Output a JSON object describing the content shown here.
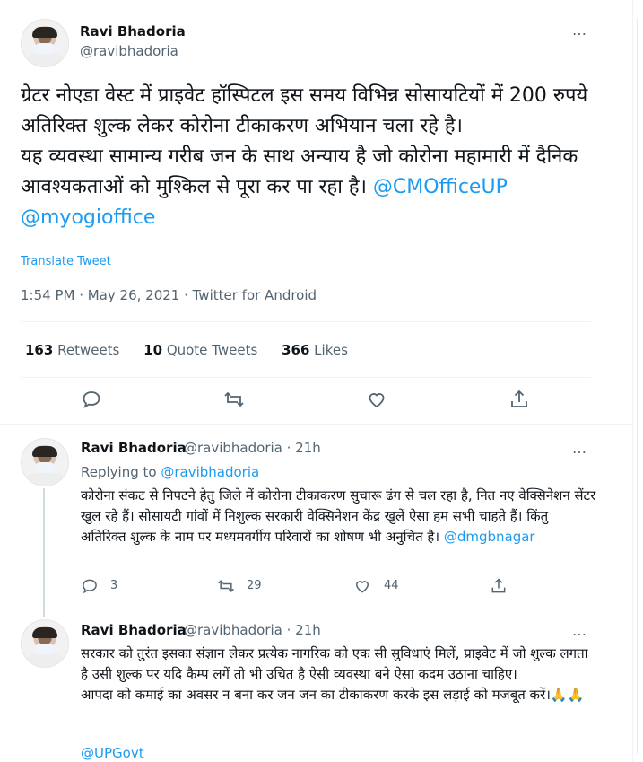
{
  "main_tweet": {
    "author_name": "Ravi Bhadoria",
    "author_handle": "@ravibhadoria",
    "more_icon": "…",
    "text": "ग्रेटर नोएडा वेस्ट में प्राइवेट हॉस्पिटल इस समय विभिन्न सोसायटियों में 200 रुपये अतिरिक्त शुल्क लेकर कोरोना टीकाकरण अभियान चला रहे है।\nयह व्यवस्था सामान्य गरीब जन के साथ अन्याय है जो कोरोना महामारी में दैनिक आवश्यकताओं को मुश्किल से पूरा कर पा रहा है। ",
    "mention_1": "@CMOfficeUP",
    "mention_2": "@myogioffice",
    "translate_label": "Translate Tweet",
    "meta": "1:54 PM · May 26, 2021 · Twitter for Android",
    "stats": {
      "retweets_count": "163",
      "retweets_label": "Retweets",
      "quote_count": "10",
      "quote_label": "Quote Tweets",
      "likes_count": "366",
      "likes_label": "Likes"
    }
  },
  "replies": [
    {
      "author_name": "Ravi Bhadoria",
      "author_handle": "@ravibhadoria · 21h",
      "more_icon": "…",
      "replying_label": "Replying to",
      "replying_handle": "@ravibhadoria",
      "text": "कोरोना संकट से निपटने हेतु जिले में कोरोना टीकाकरण सुचारू ढंग से चल रहा है, नित नए वेक्सिनेशन सेंटर खुल रहे हैं। सोसायटी गांवों में निशुल्क सरकारी वेक्सिनेशन केंद्र खुलें ऐसा हम सभी चाहते हैं। किंतु अतिरिक्त शुल्क के नाम पर मध्यमवर्गीय परिवारों का शोषण भी अनुचित है। ",
      "mention": "@dmgbnagar",
      "reply_count": "3",
      "retweet_count": "29",
      "like_count": "44"
    },
    {
      "author_name": "Ravi Bhadoria",
      "author_handle": "@ravibhadoria · 21h",
      "more_icon": "…",
      "text": "सरकार को तुरंत इसका संज्ञान लेकर प्रत्येक नागरिक को एक सी सुविधाएं मिलें, प्राइवेट में जो शुल्क लगता है उसी शुल्क पर यदि कैम्प लगें तो भी उचित है ऐसी व्यवस्था बने ऐसा कदम उठाना चाहिए।\nआपदा को कमाई का अवसर न बना कर जन जन का टीकाकरण करके इस लड़ाई को मजबूत करें।🙏🙏",
      "mention": "@UPGovt"
    }
  ],
  "colors": {
    "accent": "#1d9bf0",
    "secondary_text": "#536471",
    "primary_text": "#0f1419",
    "divider": "#eff3f4"
  },
  "icons": [
    "reply-icon",
    "retweet-icon",
    "like-icon",
    "share-icon",
    "more-icon"
  ]
}
